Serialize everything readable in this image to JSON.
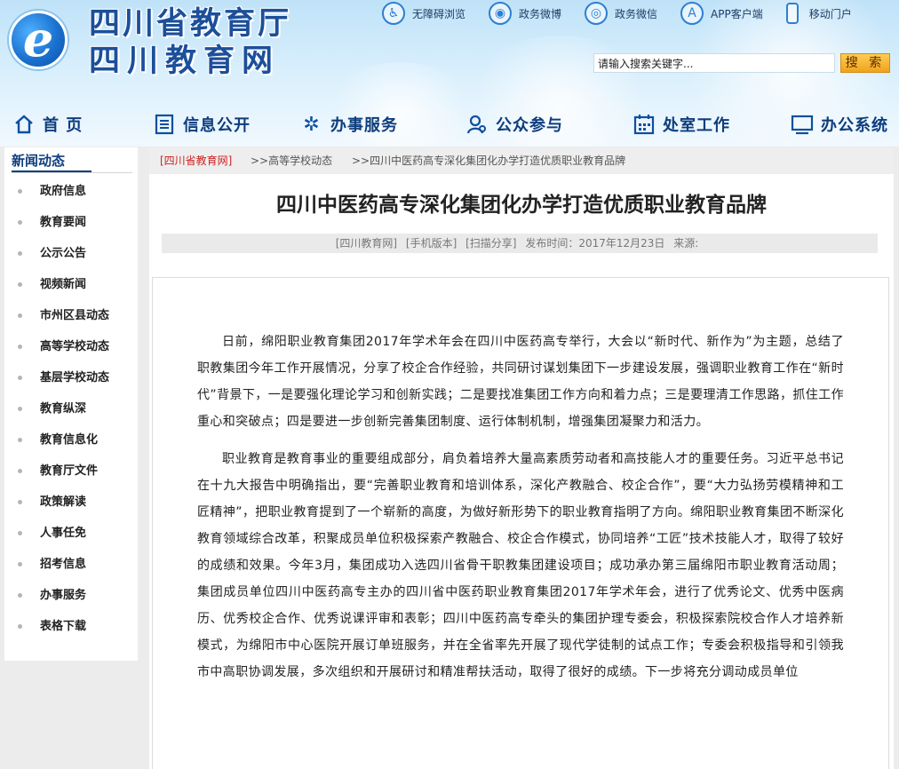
{
  "header": {
    "title_line1": "四川省教育厅",
    "title_line2": "四川教育网",
    "top_links": [
      {
        "label": "无障碍浏览",
        "icon": "accessibility-icon"
      },
      {
        "label": "政务微博",
        "icon": "weibo-icon"
      },
      {
        "label": "政务微信",
        "icon": "wechat-icon"
      },
      {
        "label": "APP客户端",
        "icon": "app-store-icon"
      },
      {
        "label": "移动门户",
        "icon": "mobile-phone-icon"
      }
    ],
    "search": {
      "value": "请输入搜索关键字...",
      "button_label": "搜 索"
    }
  },
  "nav": [
    {
      "label": "首 页",
      "icon": "home-icon"
    },
    {
      "label": "信息公开",
      "icon": "document-list-icon"
    },
    {
      "label": "办事服务",
      "icon": "gear-icon"
    },
    {
      "label": "公众参与",
      "icon": "person-search-icon"
    },
    {
      "label": "处室工作",
      "icon": "calendar-icon"
    },
    {
      "label": "办公系统",
      "icon": "monitor-icon"
    }
  ],
  "sidebar": {
    "heading": "新闻动态",
    "items": [
      "政府信息",
      "教育要闻",
      "公示公告",
      "视频新闻",
      "市州区县动态",
      "高等学校动态",
      "基层学校动态",
      "教育纵深",
      "教育信息化",
      "教育厅文件",
      "政策解读",
      "人事任免",
      "招考信息",
      "办事服务",
      "表格下载"
    ]
  },
  "breadcrumb": {
    "home": "[四川省教育网]",
    "level1": ">>高等学校动态",
    "level2": ">>四川中医药高专深化集团化办学打造优质职业教育品牌"
  },
  "article": {
    "title": "四川中医药高专深化集团化办学打造优质职业教育品牌",
    "meta": {
      "source": "[四川教育网]",
      "mobile": "[手机版本]",
      "share": "[扫描分享]",
      "date": "发布时间：2017年12月23日",
      "from": "来源:"
    },
    "paragraphs": [
      "日前，绵阳职业教育集团2017年学术年会在四川中医药高专举行，大会以“新时代、新作为”为主题，总结了职教集团今年工作开展情况，分享了校企合作经验，共同研讨谋划集团下一步建设发展，强调职业教育工作在“新时代”背景下，一是要强化理论学习和创新实践；二是要找准集团工作方向和着力点；三是要理清工作思路，抓住工作重心和突破点；四是要进一步创新完善集团制度、运行体制机制，增强集团凝聚力和活力。",
      "职业教育是教育事业的重要组成部分，肩负着培养大量高素质劳动者和高技能人才的重要任务。习近平总书记在十九大报告中明确指出，要“完善职业教育和培训体系，深化产教融合、校企合作”，要“大力弘扬劳模精神和工匠精神”，把职业教育提到了一个崭新的高度，为做好新形势下的职业教育指明了方向。绵阳职业教育集团不断深化教育领域综合改革，积聚成员单位积极探索产教融合、校企合作模式，协同培养“工匠”技术技能人才，取得了较好的成绩和效果。今年3月，集团成功入选四川省骨干职教集团建设项目；成功承办第三届绵阳市职业教育活动周；集团成员单位四川中医药高专主办的四川省中医药职业教育集团2017年学术年会，进行了优秀论文、优秀中医病历、优秀校企合作、优秀说课评审和表彰；四川中医药高专牵头的集团护理专委会，积极探索院校合作人才培养新模式，为绵阳市中心医院开展订单班服务，并在全省率先开展了现代学徒制的试点工作；专委会积极指导和引领我市中高职协调发展，多次组织和开展研讨和精准帮扶活动，取得了很好的成绩。下一步将充分调动成员单位"
    ]
  }
}
